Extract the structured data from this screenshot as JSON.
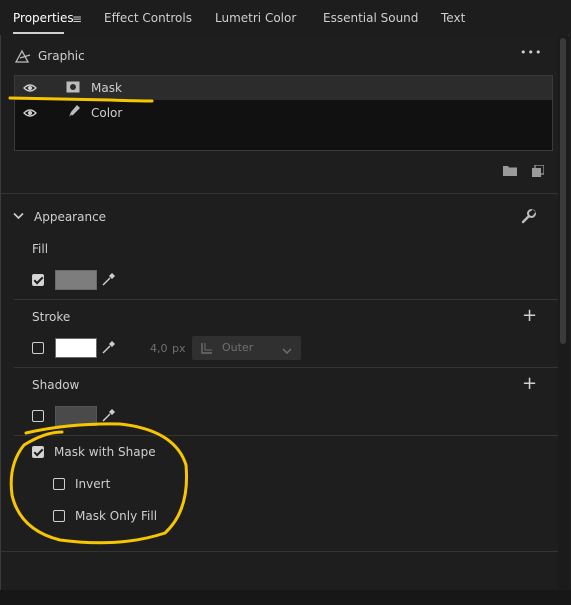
{
  "tabs": [
    {
      "label": "Properties",
      "active": true
    },
    {
      "label": "Effect Controls",
      "active": false
    },
    {
      "label": "Lumetri Color",
      "active": false
    },
    {
      "label": "Essential Sound",
      "active": false
    },
    {
      "label": "Text",
      "active": false
    }
  ],
  "tab_menu_glyph": "≡",
  "graphic": {
    "title": "Graphic",
    "more_glyph": "•••",
    "layers": [
      {
        "label": "Mask",
        "icon": "mask-layer-icon",
        "visible": true,
        "selected": true
      },
      {
        "label": "Color",
        "icon": "pen-icon",
        "visible": true,
        "selected": false
      }
    ]
  },
  "appearance": {
    "title": "Appearance",
    "fill": {
      "label": "Fill",
      "checked": true,
      "color": "#7d7d7d"
    },
    "stroke": {
      "label": "Stroke",
      "checked": false,
      "color": "#ffffff",
      "width": "4,0",
      "unit": "px",
      "position": "Outer"
    },
    "shadow": {
      "label": "Shadow",
      "checked": false,
      "color": "#4a4a4a"
    }
  },
  "mask": {
    "mask_with_shape": {
      "label": "Mask with Shape",
      "checked": true
    },
    "invert": {
      "label": "Invert",
      "checked": false
    },
    "mask_only_fill": {
      "label": "Mask Only Fill",
      "checked": false
    }
  },
  "colors": {
    "annotation": "#f7c600",
    "panel_bg": "#1e1e1e",
    "selected_row": "#2c2c2c"
  }
}
